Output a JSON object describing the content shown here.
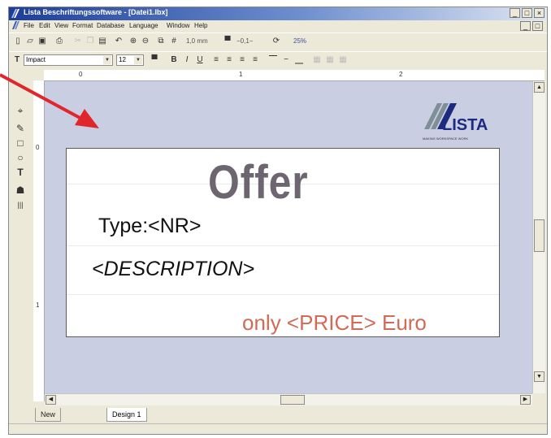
{
  "window": {
    "title": "Lista Beschriftungssoftware - [Datei1.lbx]",
    "min_btn": "_",
    "max_btn": "□",
    "close_btn": "×"
  },
  "menu": [
    "File",
    "Edit",
    "View",
    "Format",
    "Database",
    "Language",
    "Window",
    "Help"
  ],
  "toolbar1": {
    "size_text": "1,0 mm",
    "line_text": "−0,1−",
    "zoom_text": "25%"
  },
  "toolbar2": {
    "font_name": "Impact",
    "font_size": "12",
    "bold": "B",
    "italic": "I",
    "underline": "U"
  },
  "ruler": {
    "h": [
      "0",
      "1",
      "2"
    ],
    "v": [
      "0",
      "1"
    ]
  },
  "label": {
    "title": "Offer",
    "type_line": "Type:<NR>",
    "description": "<DESCRIPTION>",
    "price": "only <PRICE> Euro"
  },
  "logo": {
    "name": "LISTA",
    "tagline": "MAKING WORKSPACE WORK"
  },
  "tabs": [
    "New",
    "Design 1"
  ],
  "colors": {
    "annotation_arrow": "#e0262b",
    "canvas": "#c9cee2",
    "price": "#d26a55",
    "offer": "#6d6670"
  }
}
